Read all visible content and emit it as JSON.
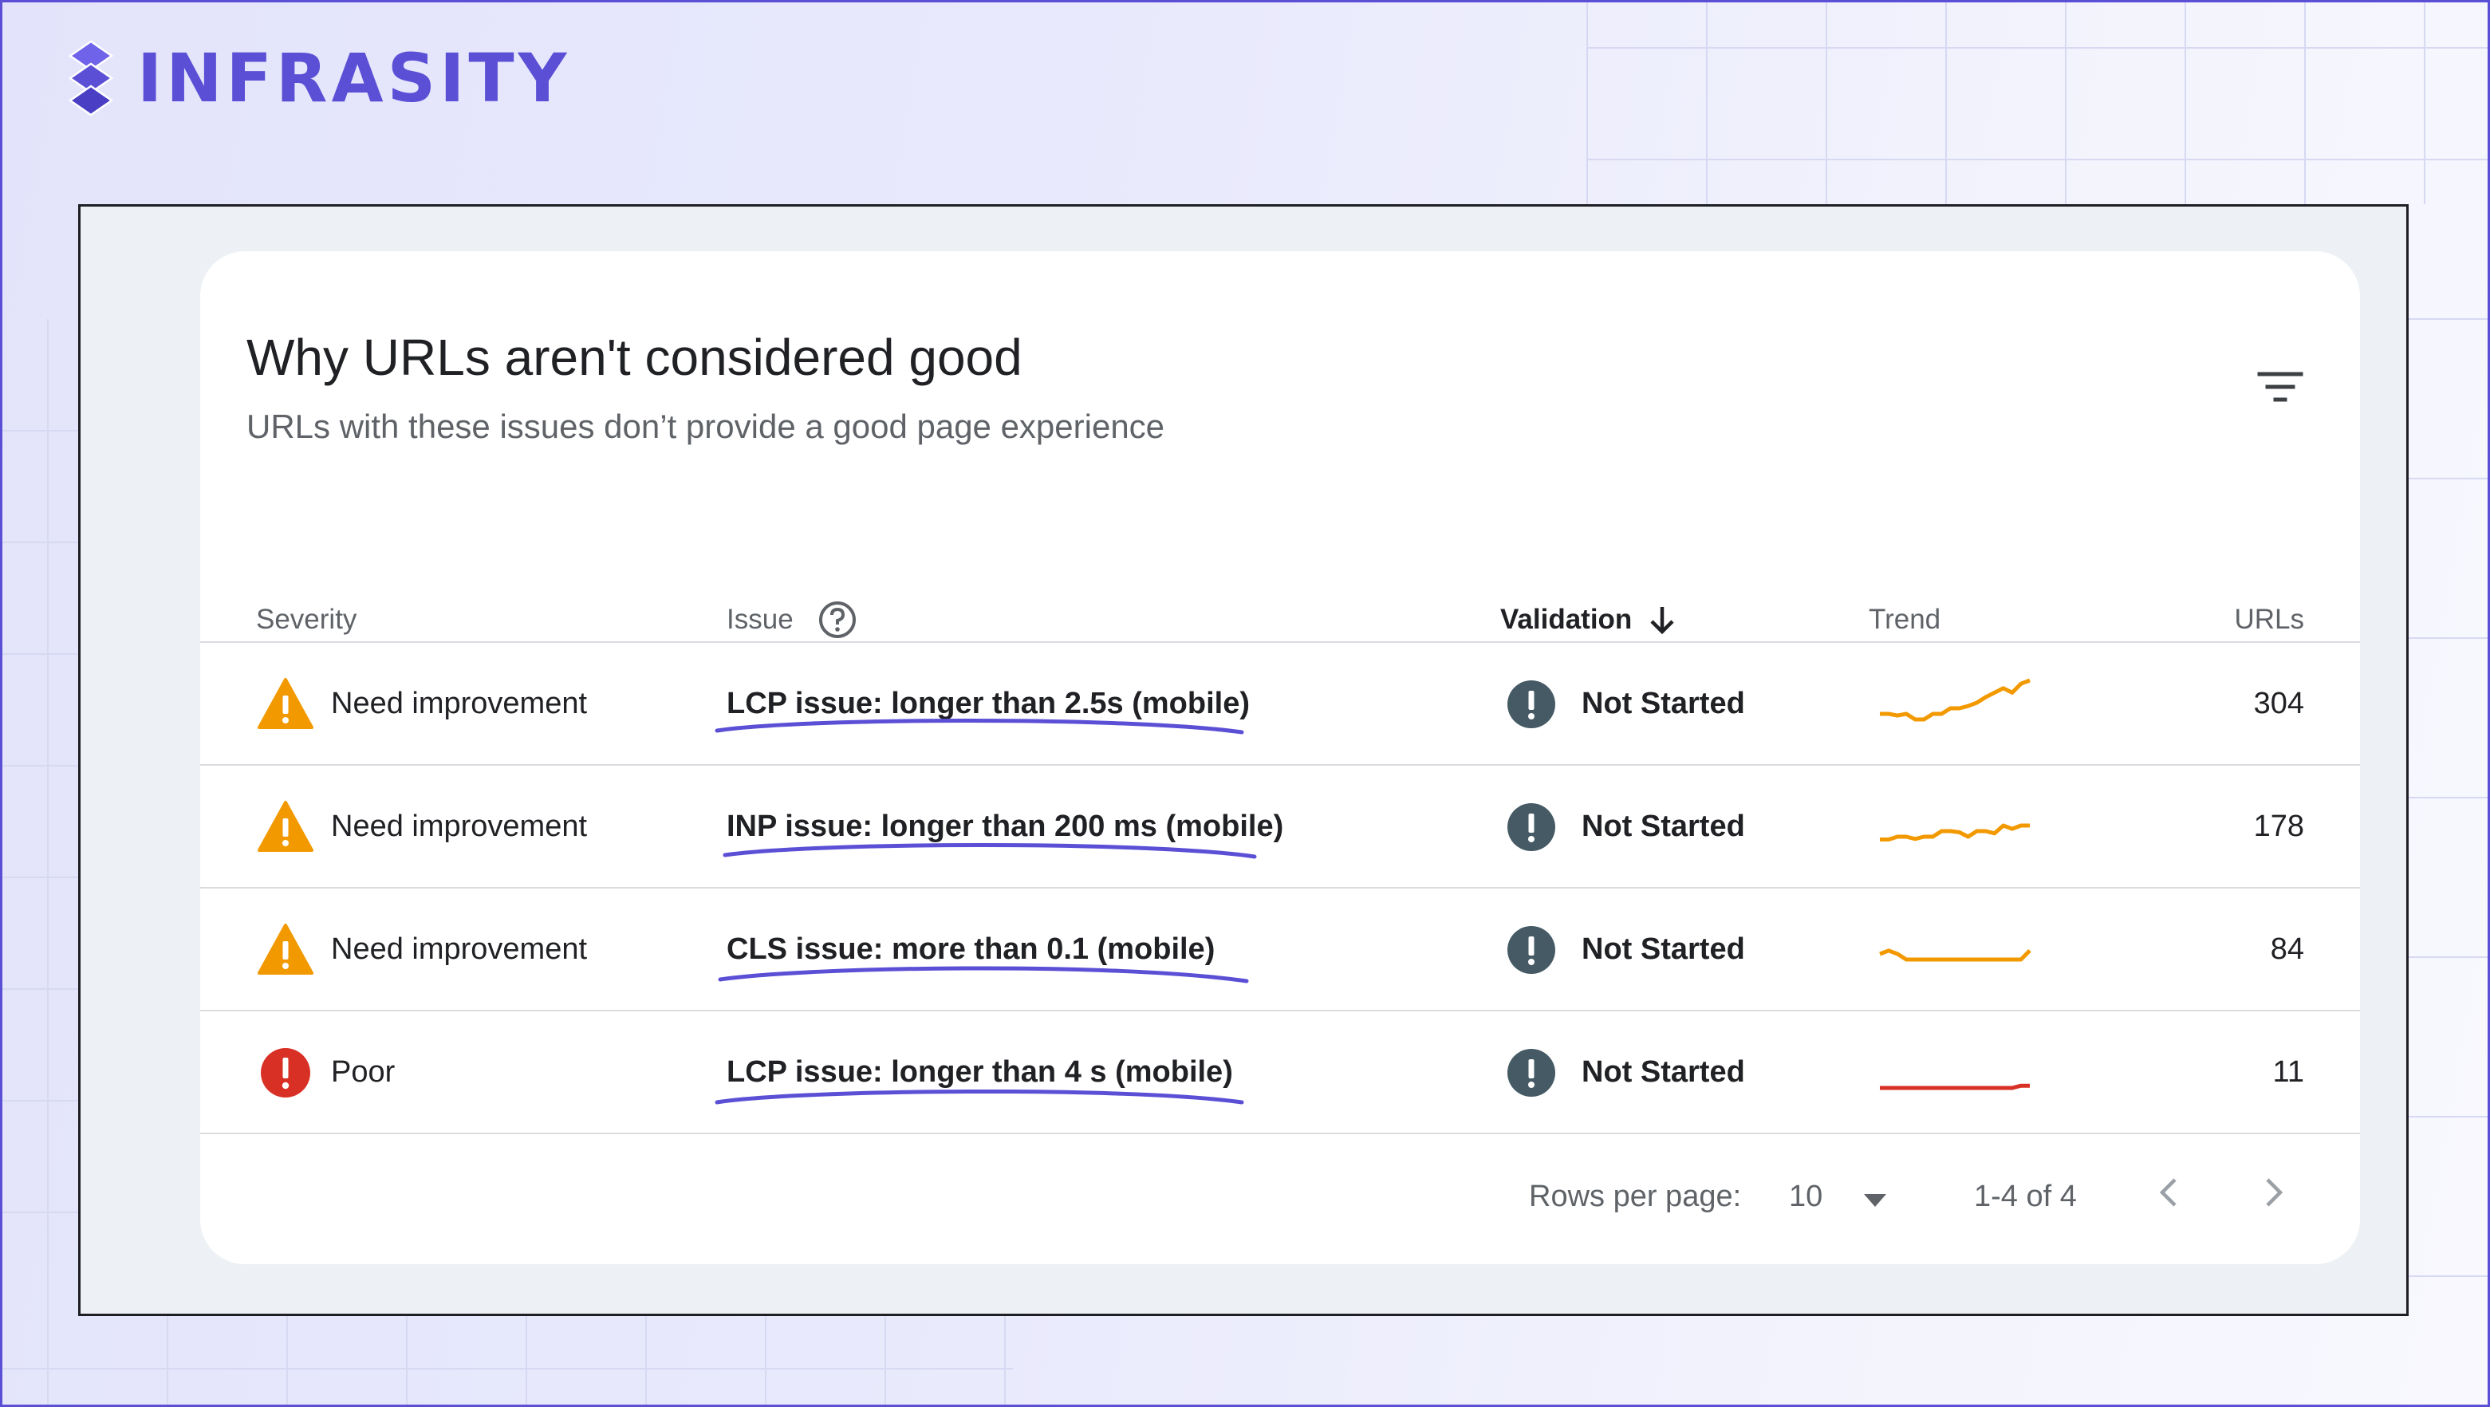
{
  "brand": {
    "name": "INFRASITY",
    "color": "#5b4fd6"
  },
  "card": {
    "title": "Why URLs aren't considered good",
    "subtitle": "URLs with these issues don’t provide a good page experience",
    "filter_icon": "filter-list-icon"
  },
  "table": {
    "headers": {
      "severity": "Severity",
      "issue": "Issue",
      "validation": "Validation",
      "trend": "Trend",
      "urls": "URLs"
    },
    "rows": [
      {
        "severity": "Need improvement",
        "severity_icon": "warning-triangle-icon",
        "issue": "LCP issue: longer than 2.5s (mobile)",
        "validation": "Not Started",
        "urls": "304",
        "trend_color": "#f29900",
        "trend_values": [
          3,
          3,
          2.7,
          3,
          2,
          2,
          3,
          3,
          4,
          4,
          4.4,
          5,
          6,
          6.8,
          7.6,
          6.8,
          8.4,
          9
        ]
      },
      {
        "severity": "Need improvement",
        "severity_icon": "warning-triangle-icon",
        "issue": "INP issue: longer than 200 ms (mobile)",
        "validation": "Not Started",
        "urls": "178",
        "trend_color": "#f29900",
        "trend_values": [
          2.5,
          2.5,
          3,
          3,
          2.6,
          3,
          3,
          4,
          4,
          3.8,
          3,
          4,
          4,
          3.6,
          5,
          4.4,
          5,
          5
        ]
      },
      {
        "severity": "Need improvement",
        "severity_icon": "warning-triangle-icon",
        "issue": "CLS issue: more than 0.1 (mobile)",
        "validation": "Not Started",
        "urls": "84",
        "trend_color": "#f29900",
        "trend_values": [
          4,
          4.6,
          4,
          3,
          3,
          3,
          3,
          3,
          3,
          3,
          3,
          3,
          3,
          3,
          3,
          3,
          3,
          4.6
        ]
      },
      {
        "severity": "Poor",
        "severity_icon": "error-circle-icon",
        "issue": "LCP issue: longer than 4 s (mobile)",
        "validation": "Not Started",
        "urls": "11",
        "trend_color": "#d93025",
        "trend_values": [
          2,
          2,
          2,
          2,
          2,
          2,
          2,
          2,
          2,
          2,
          2,
          2,
          2,
          2,
          2,
          2,
          2.4,
          2.4
        ]
      }
    ]
  },
  "footer": {
    "rows_per_page_label": "Rows per page:",
    "rows_per_page_value": "10",
    "range": "1-4 of 4"
  }
}
